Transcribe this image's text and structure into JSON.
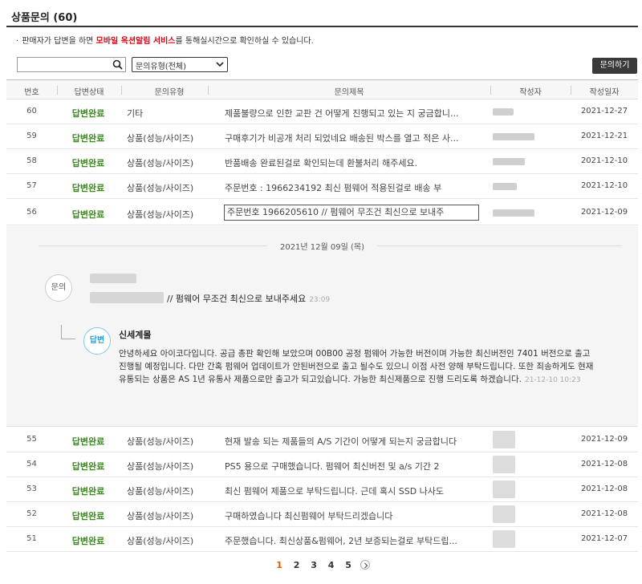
{
  "header": {
    "title": "상품문의 (60)"
  },
  "notice": {
    "bullet": "·",
    "prefix": "판매자가 답변을 하면",
    "highlight": "모바일 옥션알림 서비스",
    "suffix": "를 통해실시간으로 확인하실 수 있습니다."
  },
  "filters": {
    "search_value": "",
    "type_select": "문의유형(전체)",
    "ask_button": "문의하기"
  },
  "table": {
    "headers": [
      "번호",
      "답변상태",
      "문의유형",
      "문의제목",
      "작성자",
      "작성일자"
    ],
    "rows_top": [
      {
        "no": "60",
        "status": "답변완료",
        "type": "기타",
        "title": "제품불량으로 인한 교판 건 어떻게 진행되고 있는 지 궁금합니...",
        "date": "2021-12-27"
      },
      {
        "no": "59",
        "status": "답변완료",
        "type": "상품(성능/사이즈)",
        "title": "구매후기가 비공개 처리 되었네요 배송된 박스를 열고 적은 사...",
        "date": "2021-12-21"
      },
      {
        "no": "58",
        "status": "답변완료",
        "type": "상품(성능/사이즈)",
        "title": "반품배송 완료된걸로 확인되는데 환불처리 해주세요.",
        "date": "2021-12-10"
      },
      {
        "no": "57",
        "status": "답변완료",
        "type": "상품(성능/사이즈)",
        "title": "주문번호 : 1966234192 최신 펌웨어 적용된걸로 배송 부",
        "date": "2021-12-10"
      },
      {
        "no": "56",
        "status": "답변완료",
        "type": "상품(성능/사이즈)",
        "title": "주문번호 1966205610 // 펌웨어 무조건 최신으로 보내주",
        "date": "2021-12-09"
      }
    ],
    "rows_bottom": [
      {
        "no": "55",
        "status": "답변완료",
        "type": "상품(성능/사이즈)",
        "title": "현재 발송 되는 제품들의 A/S 기간이 어떻게 되는지 궁금합니다",
        "date": "2021-12-09"
      },
      {
        "no": "54",
        "status": "답변완료",
        "type": "상품(성능/사이즈)",
        "title": "PS5 용으로 구매했습니다. 펌웨어 최신버전 및 a/s 기간 2",
        "date": "2021-12-08"
      },
      {
        "no": "53",
        "status": "답변완료",
        "type": "상품(성능/사이즈)",
        "title": "최신 펌웨어 제품으로 부탁드립니다. 근데 혹시 SSD 나사도",
        "date": "2021-12-08"
      },
      {
        "no": "52",
        "status": "답변완료",
        "type": "상품(성능/사이즈)",
        "title": "구매하였습니다 최신펌웨어 부탁드리겠습니다",
        "date": "2021-12-08"
      },
      {
        "no": "51",
        "status": "답변완료",
        "type": "상품(성능/사이즈)",
        "title": "주문했습니다. 최신상품&펌웨어, 2년 보증되는걸로 부탁드립...",
        "date": "2021-12-07"
      }
    ]
  },
  "detail": {
    "date": "2021년 12월 09일 (목)",
    "question_badge": "문의",
    "question_text": "// 펌웨어 무조건 최신으로 보내주세요",
    "question_time": "23:09",
    "answer_badge": "답변",
    "answer_name": "신세계몰",
    "answer_text": "안녕하세요 아이코다입니다. 공급 총판 확인해 보았으며 00B00 공정 펌웨어 가능한 버전이며 가능한 최신버전인 7401 버전으로 출고 진행될 예정입니다. 다만 간혹 펌웨어 업데이트가 안된버전으로 출고 될수도 있으니 이점 사전 양해 부탁드립니다. 또한 죄송하게도 현재 유통되는 상품은 AS 1년 유통사 제품으로만 출고가 되고있습니다. 가능한 최신제품으로 진행 드리도록 하겠습니다.",
    "answer_time": "21-12-10 10:23"
  },
  "pagination": {
    "pages": [
      "1",
      "2",
      "3",
      "4",
      "5"
    ],
    "current": "1"
  }
}
